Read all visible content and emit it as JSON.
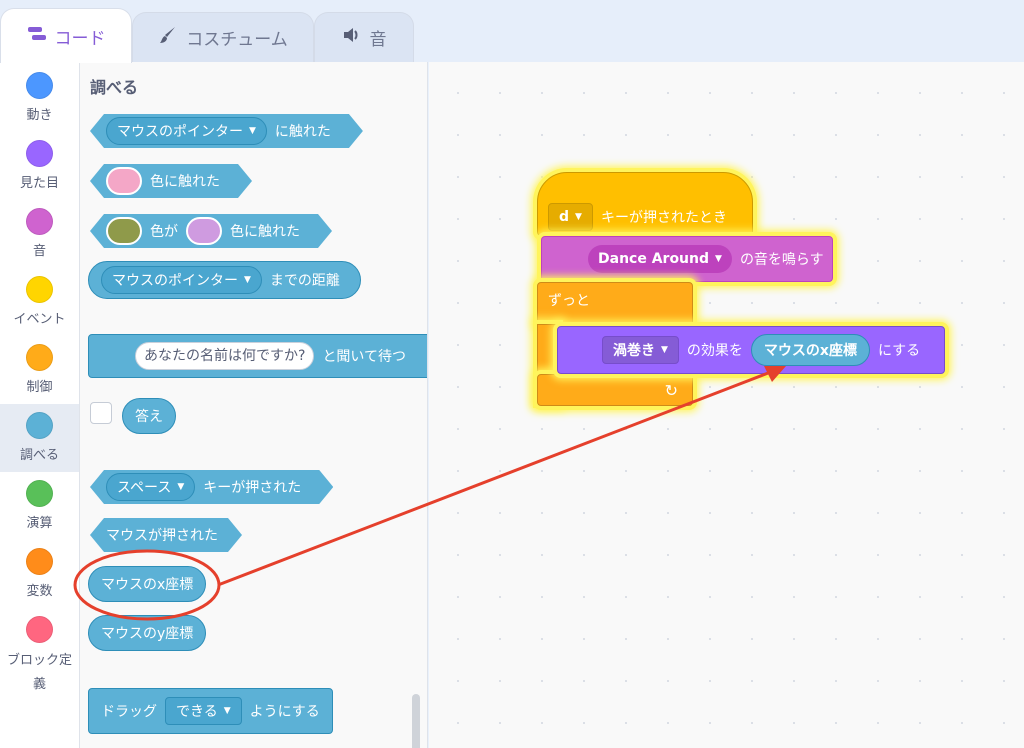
{
  "tabs": {
    "code": "コード",
    "costume": "コスチューム",
    "sound": "音"
  },
  "categories": [
    {
      "label": "動き",
      "color": "#4c97ff"
    },
    {
      "label": "見た目",
      "color": "#9966ff"
    },
    {
      "label": "音",
      "color": "#cf63cf"
    },
    {
      "label": "イベント",
      "color": "#ffd500"
    },
    {
      "label": "制御",
      "color": "#ffab19"
    },
    {
      "label": "調べる",
      "color": "#5cb1d6"
    },
    {
      "label": "演算",
      "color": "#59c059"
    },
    {
      "label": "変数",
      "color": "#ff8c1a"
    },
    {
      "label": "ブロック定\n義",
      "color": "#ff6680"
    }
  ],
  "palette": {
    "title": "調べる",
    "touching_dropdown": "マウスのポインター",
    "touching_suffix": "に触れた",
    "touching_color_suffix": "色に触れた",
    "color_is_label": "色が",
    "color_touching_suffix": "色に触れた",
    "distance_dropdown": "マウスのポインター",
    "distance_suffix": "までの距離",
    "ask_input": "あなたの名前は何ですか?",
    "ask_suffix": "と聞いて待つ",
    "answer": "答え",
    "key_dropdown": "スペース",
    "key_suffix": "キーが押された",
    "mouse_down": "マウスが押された",
    "mouse_x": "マウスのx座標",
    "mouse_y": "マウスのy座標",
    "drag_prefix": "ドラッグ",
    "drag_dropdown": "できる",
    "drag_suffix": "ようにする",
    "pink_swatch": "#f4a7c7",
    "olive_swatch": "#8f9a4a",
    "purple_swatch": "#cf9be0"
  },
  "script": {
    "hat_key": "d",
    "hat_label": "キーが押されたとき",
    "sound_dropdown": "Dance Around",
    "sound_suffix": "の音を鳴らす",
    "forever": "ずっと",
    "effect_dropdown": "渦巻き",
    "effect_mid": "の効果を",
    "effect_value": "マウスのx座標",
    "effect_suffix": "にする",
    "loop_arrow": "↻"
  },
  "annotation_color": "#e5402c"
}
